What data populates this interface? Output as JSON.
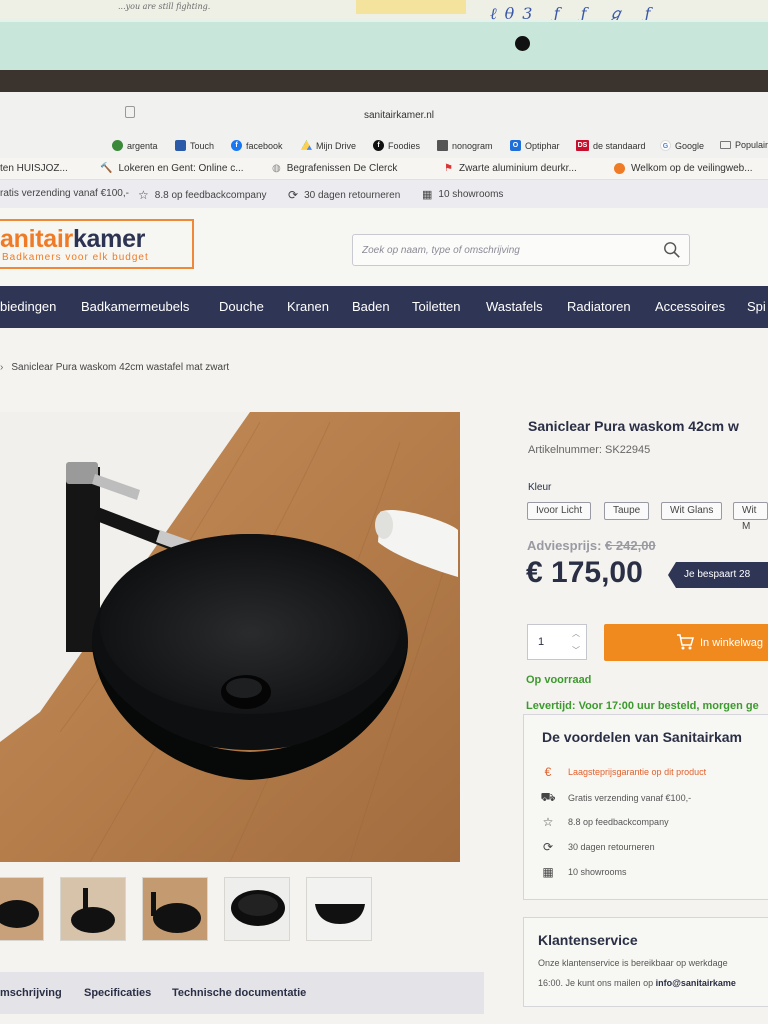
{
  "photo": {
    "paper_text": "...you are still fighting.",
    "paper_scribble": "ℓθ3  ƒ  ƒ  ℊ  ƒ"
  },
  "browser": {
    "url": "sanitairkamer.nl",
    "bookmarks": [
      {
        "label": "argenta",
        "icon": "leaf-icon",
        "color": "#3a8a3a"
      },
      {
        "label": "Touch",
        "icon": "touch-icon",
        "color": "#2b5aa8"
      },
      {
        "label": "facebook",
        "icon": "facebook-icon",
        "color": "#1877f2"
      },
      {
        "label": "Mijn Drive",
        "icon": "drive-icon",
        "color": "#1fa463"
      },
      {
        "label": "Foodies",
        "icon": "foodies-icon",
        "color": "#111111"
      },
      {
        "label": "nonogram",
        "icon": "nonogram-icon",
        "color": "#555555"
      },
      {
        "label": "Optiphar",
        "icon": "optiphar-icon",
        "color": "#1e6fd9"
      },
      {
        "label": "de standaard",
        "icon": "ds-icon",
        "color": "#c8102e"
      },
      {
        "label": "Google",
        "icon": "google-icon",
        "color": "#4285f4"
      },
      {
        "label": "Populair",
        "icon": "folder-icon",
        "color": "#777777"
      }
    ],
    "tabs": [
      {
        "label": "ten HUISJOZ...",
        "icon": ""
      },
      {
        "label": "Lokeren en Gent: Online c...",
        "icon": "hammer-icon"
      },
      {
        "label": "Begrafenissen De Clerck",
        "icon": "globe-icon"
      },
      {
        "label": "Zwarte aluminium deurkr...",
        "icon": "flag-icon"
      },
      {
        "label": "Welkom op de veilingweb...",
        "icon": "auction-icon"
      }
    ]
  },
  "usp_bar": [
    {
      "label": "ratis verzending vanaf €100,-",
      "icon": ""
    },
    {
      "label": "8.8 op feedbackcompany",
      "icon": "star-icon"
    },
    {
      "label": "30 dagen retourneren",
      "icon": "return-icon"
    },
    {
      "label": "10 showrooms",
      "icon": "store-icon"
    }
  ],
  "logo": {
    "main_orange": "anitair",
    "main_dark": "kamer",
    "sub": "Badkamers voor elk budget"
  },
  "search": {
    "placeholder": "Zoek op naam, type of omschrijving"
  },
  "nav": [
    "biedingen",
    "Badkamermeubels",
    "Douche",
    "Kranen",
    "Baden",
    "Toiletten",
    "Wastafels",
    "Radiatoren",
    "Accessoires",
    "Spi"
  ],
  "breadcrumb": {
    "current": "Saniclear Pura waskom 42cm wastafel mat zwart"
  },
  "bottom_tabs": [
    "mschrijving",
    "Specificaties",
    "Technische documentatie"
  ],
  "product": {
    "title": "Saniclear Pura waskom 42cm w",
    "sku": "Artikelnummer: SK22945",
    "kleur_label": "Kleur",
    "colors": [
      "Ivoor Licht",
      "Taupe",
      "Wit Glans",
      "Wit M"
    ],
    "advies_label": "Adviesprijs:",
    "advies_price": "€ 242,00",
    "price": "€ 175,00",
    "saving": "Je bespaart 28",
    "qty": "1",
    "cart_label": "In winkelwag",
    "stock": "Op voorraad",
    "delivery": "Levertijd: Voor 17:00 uur besteld, morgen ge"
  },
  "benefits": {
    "title": "De voordelen van Sanitairkam",
    "items": [
      {
        "label": "Laagsteprijsgarantie op dit product",
        "icon": "euro-icon",
        "accent": true
      },
      {
        "label": "Gratis verzending vanaf €100,-",
        "icon": "truck-icon",
        "accent": false
      },
      {
        "label": "8.8 op feedbackcompany",
        "icon": "star-icon",
        "accent": false
      },
      {
        "label": "30 dagen retourneren",
        "icon": "return-icon",
        "accent": false
      },
      {
        "label": "10 showrooms",
        "icon": "store-icon",
        "accent": false
      }
    ]
  },
  "service": {
    "title": "Klantenservice",
    "line1": "Onze klantenservice is bereikbaar op werkdage",
    "line2_prefix": "16:00. Je kunt ons mailen op",
    "email": "info@sanitairkame"
  },
  "colors": {
    "navy": "#2f3554",
    "orange": "#f08a1f",
    "green": "#3c9a2e"
  }
}
